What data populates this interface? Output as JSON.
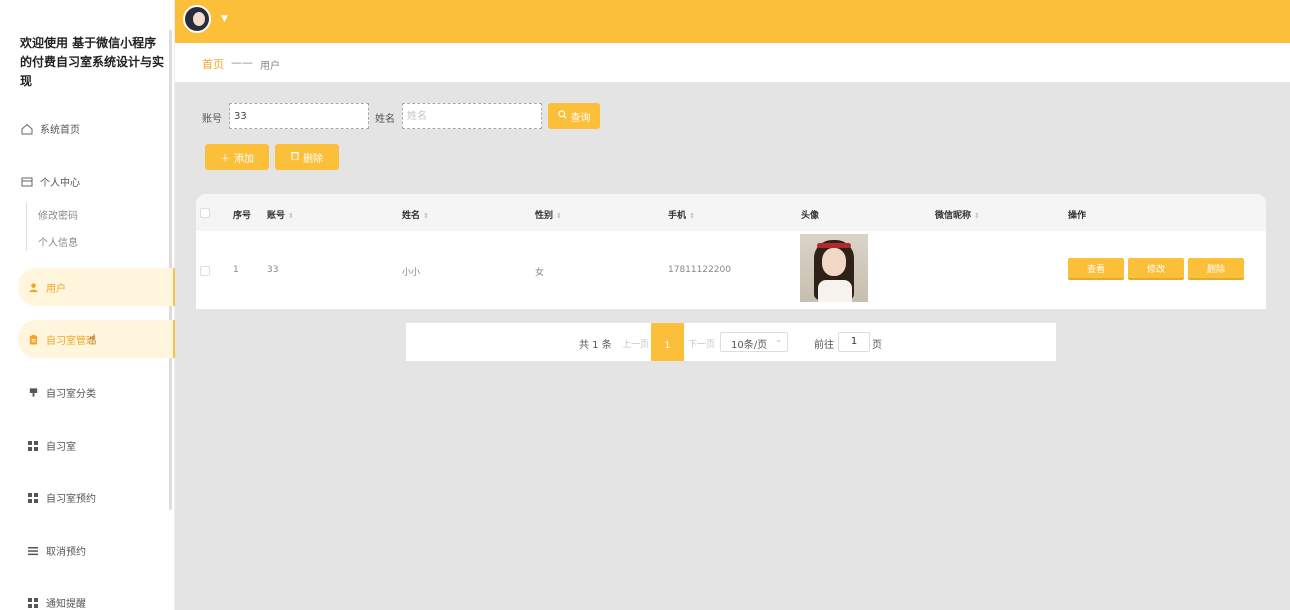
{
  "app": {
    "title": "欢迎使用 基于微信小程序的付费自习室系统设计与实现"
  },
  "sidebar": {
    "home": "系统首页",
    "personal_center": "个人中心",
    "sub_items": [
      "修改密码",
      "个人信息"
    ],
    "items": [
      {
        "label": "用户",
        "icon": "user-icon"
      },
      {
        "label": "自习室管理",
        "icon": "clipboard-icon"
      },
      {
        "label": "自习室分类",
        "icon": "category-icon"
      },
      {
        "label": "自习室",
        "icon": "grid-icon"
      },
      {
        "label": "自习室预约",
        "icon": "grid-icon"
      },
      {
        "label": "取消预约",
        "icon": "list-icon"
      },
      {
        "label": "通知提醒",
        "icon": "grid-icon"
      }
    ]
  },
  "breadcrumb": {
    "home": "首页",
    "separator": "——",
    "current": "用户"
  },
  "search": {
    "account_label": "账号",
    "account_value": "33",
    "name_label": "姓名",
    "name_placeholder": "姓名",
    "query_button": "查询"
  },
  "actions": {
    "add": "添加",
    "delete": "删除"
  },
  "table": {
    "headers": [
      "序号",
      "账号",
      "姓名",
      "性别",
      "手机",
      "头像",
      "微信昵称",
      "操作"
    ],
    "rows": [
      {
        "index": "1",
        "account": "33",
        "name": "小小",
        "gender": "女",
        "phone": "17811122200",
        "nickname": ""
      }
    ],
    "row_actions": [
      "查看",
      "修改",
      "删除"
    ]
  },
  "pagination": {
    "total": "共 1 条",
    "prev": "上一页",
    "current": "1",
    "next": "下一页",
    "page_size": "10条/页",
    "goto_label": "前往",
    "goto_value": "1",
    "page_suffix": "页"
  },
  "colors": {
    "accent": "#fcbf3a",
    "active_text": "#f5a623"
  }
}
